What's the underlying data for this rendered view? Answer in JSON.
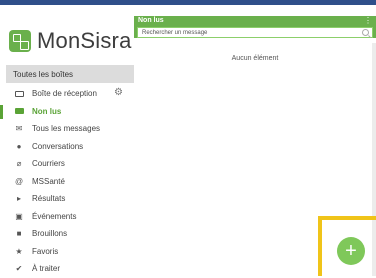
{
  "app": {
    "name": "MonSisra",
    "brand_color": "#6ab04c",
    "accent_color": "#f0c419"
  },
  "sidebar": {
    "section_title": "Toutes les boîtes",
    "items": [
      {
        "label": "Boîte de réception",
        "icon": "inbox-icon",
        "active": false,
        "has_settings": true
      },
      {
        "label": "Non lus",
        "icon": "envelope-icon",
        "active": true
      },
      {
        "label": "Tous les messages",
        "icon": "envelopes-icon",
        "active": false
      },
      {
        "label": "Conversations",
        "icon": "chat-icon",
        "active": false
      },
      {
        "label": "Courriers",
        "icon": "paperclip-icon",
        "active": false
      },
      {
        "label": "MSSanté",
        "icon": "at-icon",
        "active": false
      },
      {
        "label": "Résultats",
        "icon": "flask-icon",
        "active": false
      },
      {
        "label": "Événements",
        "icon": "calendar-icon",
        "active": false
      },
      {
        "label": "Brouillons",
        "icon": "draft-icon",
        "active": false
      },
      {
        "label": "Favoris",
        "icon": "star-icon",
        "active": false
      },
      {
        "label": "À traiter",
        "icon": "check-circle-icon",
        "active": false
      }
    ]
  },
  "main": {
    "title": "Non lus",
    "search_placeholder": "Rechercher un message",
    "empty_text": "Aucun élément"
  }
}
